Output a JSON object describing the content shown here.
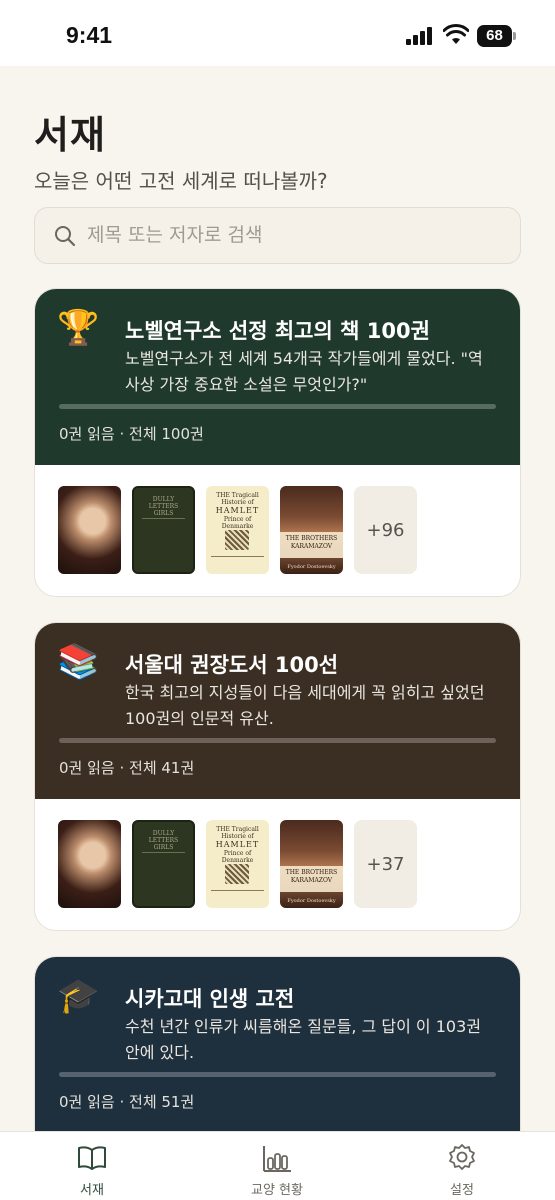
{
  "status_bar": {
    "time": "9:41",
    "battery": "68"
  },
  "header": {
    "title": "서재",
    "subtitle": "오늘은 어떤 고전 세계로 떠나볼까?"
  },
  "search": {
    "placeholder": "제목 또는 저자로 검색",
    "value": ""
  },
  "collections": [
    {
      "emoji": "🏆",
      "title": "노벨연구소 선정 최고의 책 100권",
      "description": "노벨연구소가 전 세계 54개국 작가들에게 물었다. \"역사상 가장 중요한 소설은 무엇인가?\"",
      "count_text": "0권 읽음 · 전체 100권",
      "progress": 0,
      "more_label": "+96",
      "header_color": "#1f3a2c"
    },
    {
      "emoji": "📚",
      "title": "서울대 권장도서 100선",
      "description": "한국 최고의 지성들이 다음 세대에게 꼭 읽히고 싶었던 100권의 인문적 유산.",
      "count_text": "0권 읽음 · 전체 41권",
      "progress": 0,
      "more_label": "+37",
      "header_color": "#3b2e22"
    },
    {
      "emoji": "🎓",
      "title": "시카고대 인생 고전",
      "description": "수천 년간 인류가 씨름해온 질문들, 그 답이 이 103권 안에 있다.",
      "count_text": "0권 읽음 · 전체 51권",
      "progress": 0,
      "header_color": "#1e2f3e"
    }
  ],
  "book_covers": {
    "green_title": "DULLY LETTERS GIRLS",
    "hamlet_top": "THE Tragicall Historie of",
    "hamlet_title": "HAMLET",
    "hamlet_sub": "Prince of Denmarke",
    "karamazov_title": "THE BROTHERS KARAMAZOV",
    "karamazov_author": "Fyodor Dostoevsky"
  },
  "tabs": [
    {
      "label": "서재",
      "icon": "book-open-icon",
      "active": true
    },
    {
      "label": "교양 현황",
      "icon": "bar-chart-icon",
      "active": false
    },
    {
      "label": "설정",
      "icon": "gear-icon",
      "active": false
    }
  ]
}
